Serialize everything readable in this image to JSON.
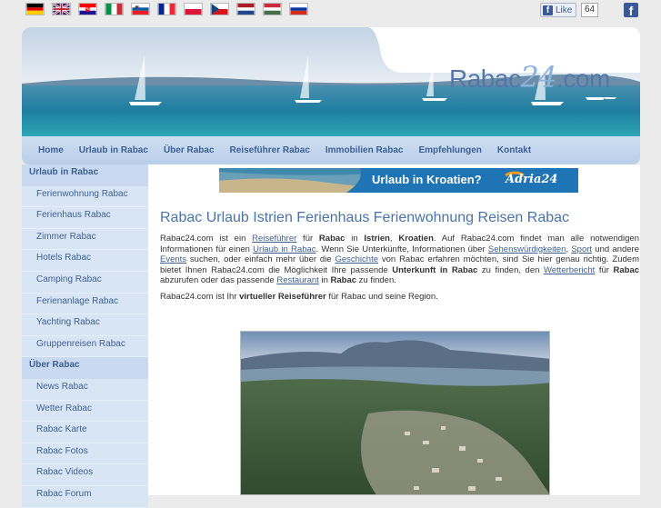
{
  "topbar": {
    "flags": [
      "flag-de",
      "flag-gb",
      "flag-hr",
      "flag-it",
      "flag-si",
      "flag-fr",
      "flag-pl",
      "flag-cz",
      "flag-nl",
      "flag-hu",
      "flag-ru"
    ],
    "like_label": "Like",
    "like_count": "64",
    "facebook_icon": "f"
  },
  "header": {
    "logo_prefix": "Rabac",
    "logo_number": "24",
    "logo_suffix": ".com"
  },
  "nav": {
    "items": [
      "Home",
      "Urlaub in Rabac",
      "Über Rabac",
      "Reiseführer Rabac",
      "Immobilien Rabac",
      "Empfehlungen",
      "Kontakt"
    ]
  },
  "sidebar": {
    "section1": "Urlaub in Rabac",
    "items1": [
      "Ferienwohnung Rabac",
      "Ferienhaus Rabac",
      "Zimmer Rabac",
      "Hotels Rabac",
      "Camping Rabac",
      "Ferienanlage Rabac",
      "Yachting Rabac",
      "Gruppenreisen Rabac"
    ],
    "section2": "Über Rabac",
    "items2": [
      "News Rabac",
      "Wetter Rabac",
      "Rabac Karte",
      "Rabac Fotos",
      "Rabac Videos",
      "Rabac Forum"
    ]
  },
  "banner": {
    "text": "Urlaub in Kroatien?",
    "logo": "Adria24"
  },
  "content": {
    "title": "Rabac Urlaub Istrien Ferienhaus Ferienwohnung Reisen Rabac",
    "p1": {
      "t1": "Rabac24.com ist ein ",
      "l1": "Reiseführer",
      "t2": " für ",
      "b1": "Rabac",
      "t3": " in ",
      "b2": "Istrien",
      "t4": ", ",
      "b3": "Kroatien",
      "t5": ". Auf Rabac24.com findet man alle notwendigen Informationen für einen ",
      "l2": "Urlaub in Rabac",
      "t6": ". Wenn Sie Unterkünfte, Informationen über ",
      "l3": "Sehenswürdigkeiten",
      "t7": ", ",
      "l4": "Sport",
      "t8": " und andere ",
      "l5": "Events",
      "t9": " suchen, oder einfach mehr über die ",
      "l6": "Geschichte",
      "t10": " von Rabac erfahren möchten, sind Sie hier genau richtig. Zudem bietet Ihnen Rabac24.com die Möglichkeit Ihre passende ",
      "b4": "Unterkunft in Rabac",
      "t11": " zu finden, den ",
      "l7": "Wetterbericht",
      "t12": " für ",
      "b5": "Rabac",
      "t13": " abzurufen oder das passende ",
      "l8": "Restaurant",
      "t14": " in ",
      "b6": "Rabac",
      "t15": " zu finden."
    },
    "p2": {
      "t1": "Rabac24.com ist Ihr ",
      "b1": "virtueller Reiseführer",
      "t2": " für Rabac und seine Region."
    }
  }
}
